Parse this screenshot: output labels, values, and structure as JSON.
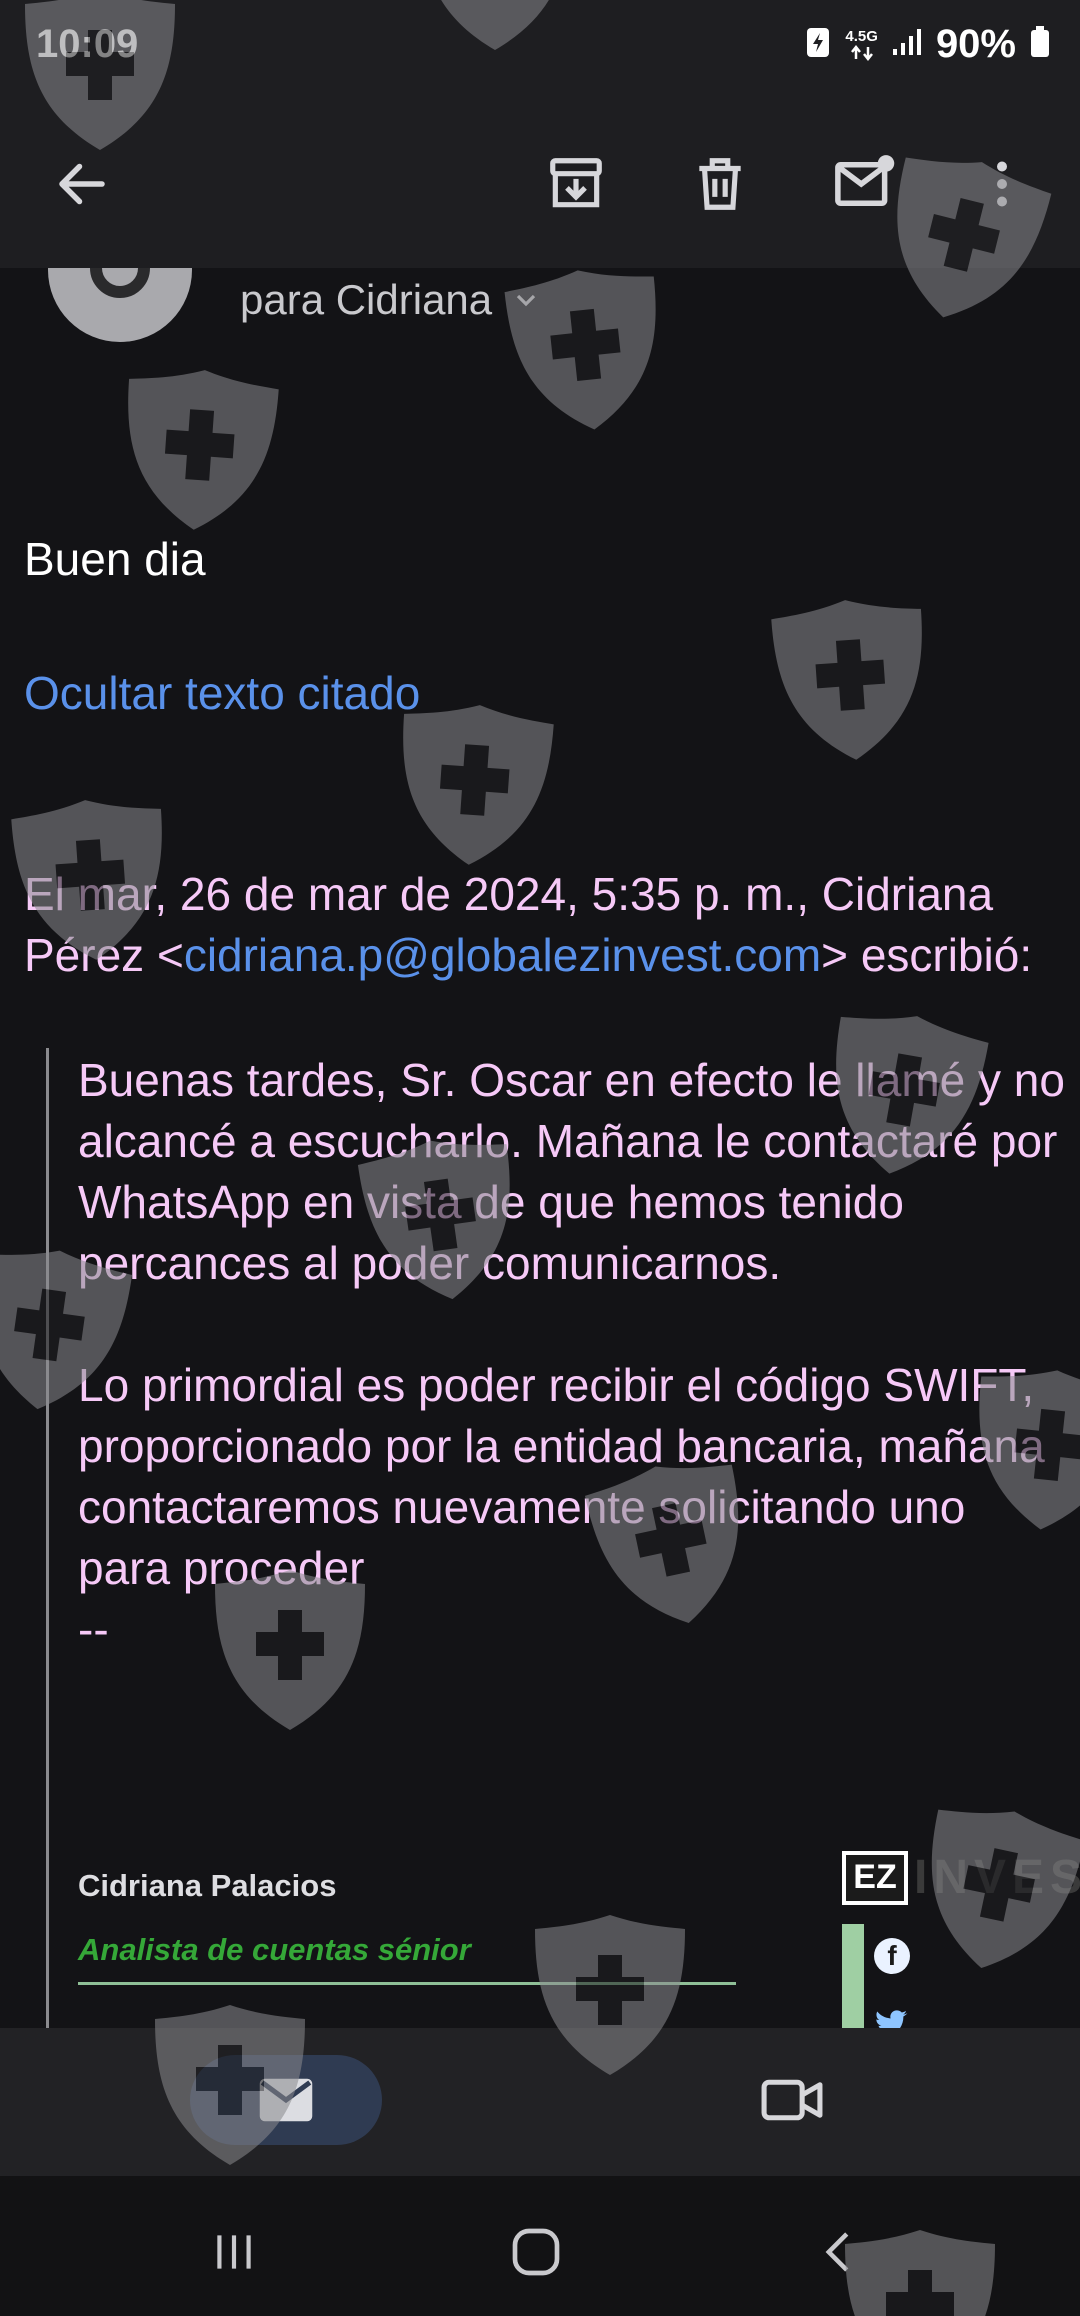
{
  "status_bar": {
    "time": "10:09",
    "network": "4.5G",
    "battery": "90%"
  },
  "toolbar": {
    "back_icon": "arrow-left-icon",
    "archive_icon": "archive-icon",
    "delete_icon": "trash-icon",
    "mark_unread_icon": "mail-unread-icon",
    "more_icon": "more-vert-icon"
  },
  "header": {
    "recipient_line": "para Cidriana"
  },
  "email": {
    "greeting": "Buen dia",
    "hide_quoted_label": "Ocultar texto citado",
    "quote_header_prefix": "El mar, 26 de mar de 2024, 5:35 p. m., Cidriana Pérez <",
    "quote_header_email": "cidriana.p@globalezinvest.com",
    "quote_header_suffix": "> escribió:",
    "quote_paragraph_1": "Buenas tardes, Sr. Oscar en efecto le llamé y no alcancé a escucharlo. Mañana le contactaré por WhatsApp en vista de que hemos tenido percances al poder comunicarnos.",
    "quote_paragraph_2": "Lo primordial es poder recibir el código SWIFT, proporcionado por la entidad bancaria, mañana contactaremos nuevamente solicitando uno para proceder",
    "signature_separator": "--",
    "signature_name": "Cidriana Palacios",
    "signature_role": "Analista de cuentas sénior",
    "logo_mark": "EZ",
    "logo_text": "INVES"
  },
  "bottom_nav": {
    "mail_icon": "mail-icon",
    "meet_icon": "video-camera-icon"
  },
  "system_nav": {
    "recents_icon": "recents-icon",
    "home_icon": "home-icon",
    "back_icon": "back-chevron-icon"
  },
  "colors": {
    "background": "#131316",
    "link": "#5a91ea",
    "quoted_text": "#f6c9f7",
    "role_green": "#35a838"
  }
}
